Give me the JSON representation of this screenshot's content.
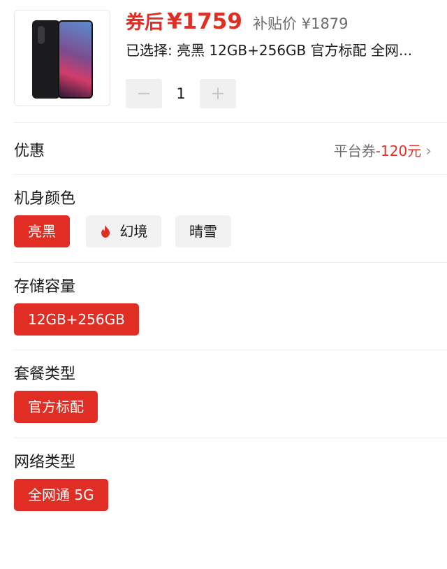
{
  "product": {
    "image_alt": "Redmi phone",
    "price_label": "券后",
    "price_value": "¥1759",
    "original_price": "补贴价 ¥1879",
    "selected_text": "已选择: 亮黑 12GB+256GB 官方标配 全网...",
    "quantity": "1",
    "minus_label": "−",
    "plus_label": "+"
  },
  "promo": {
    "title": "优惠",
    "coupon_label": "平台券",
    "coupon_amount": "-120元",
    "chevron": "›"
  },
  "options": {
    "color": {
      "title": "机身颜色",
      "items": [
        "亮黑",
        "幻境",
        "晴雪"
      ],
      "selected": "亮黑",
      "hot_icon": "flame-icon"
    },
    "storage": {
      "title": "存储容量",
      "items": [
        "12GB+256GB"
      ],
      "selected": "12GB+256GB"
    },
    "package": {
      "title": "套餐类型",
      "items": [
        "官方标配"
      ],
      "selected": "官方标配"
    },
    "network": {
      "title": "网络类型",
      "items": [
        "全网通 5G"
      ],
      "selected": "全网通 5G"
    }
  },
  "colors": {
    "accent": "#e02e24",
    "chip_inactive": "#f2f2f2",
    "muted_text": "#6b6b6b"
  }
}
